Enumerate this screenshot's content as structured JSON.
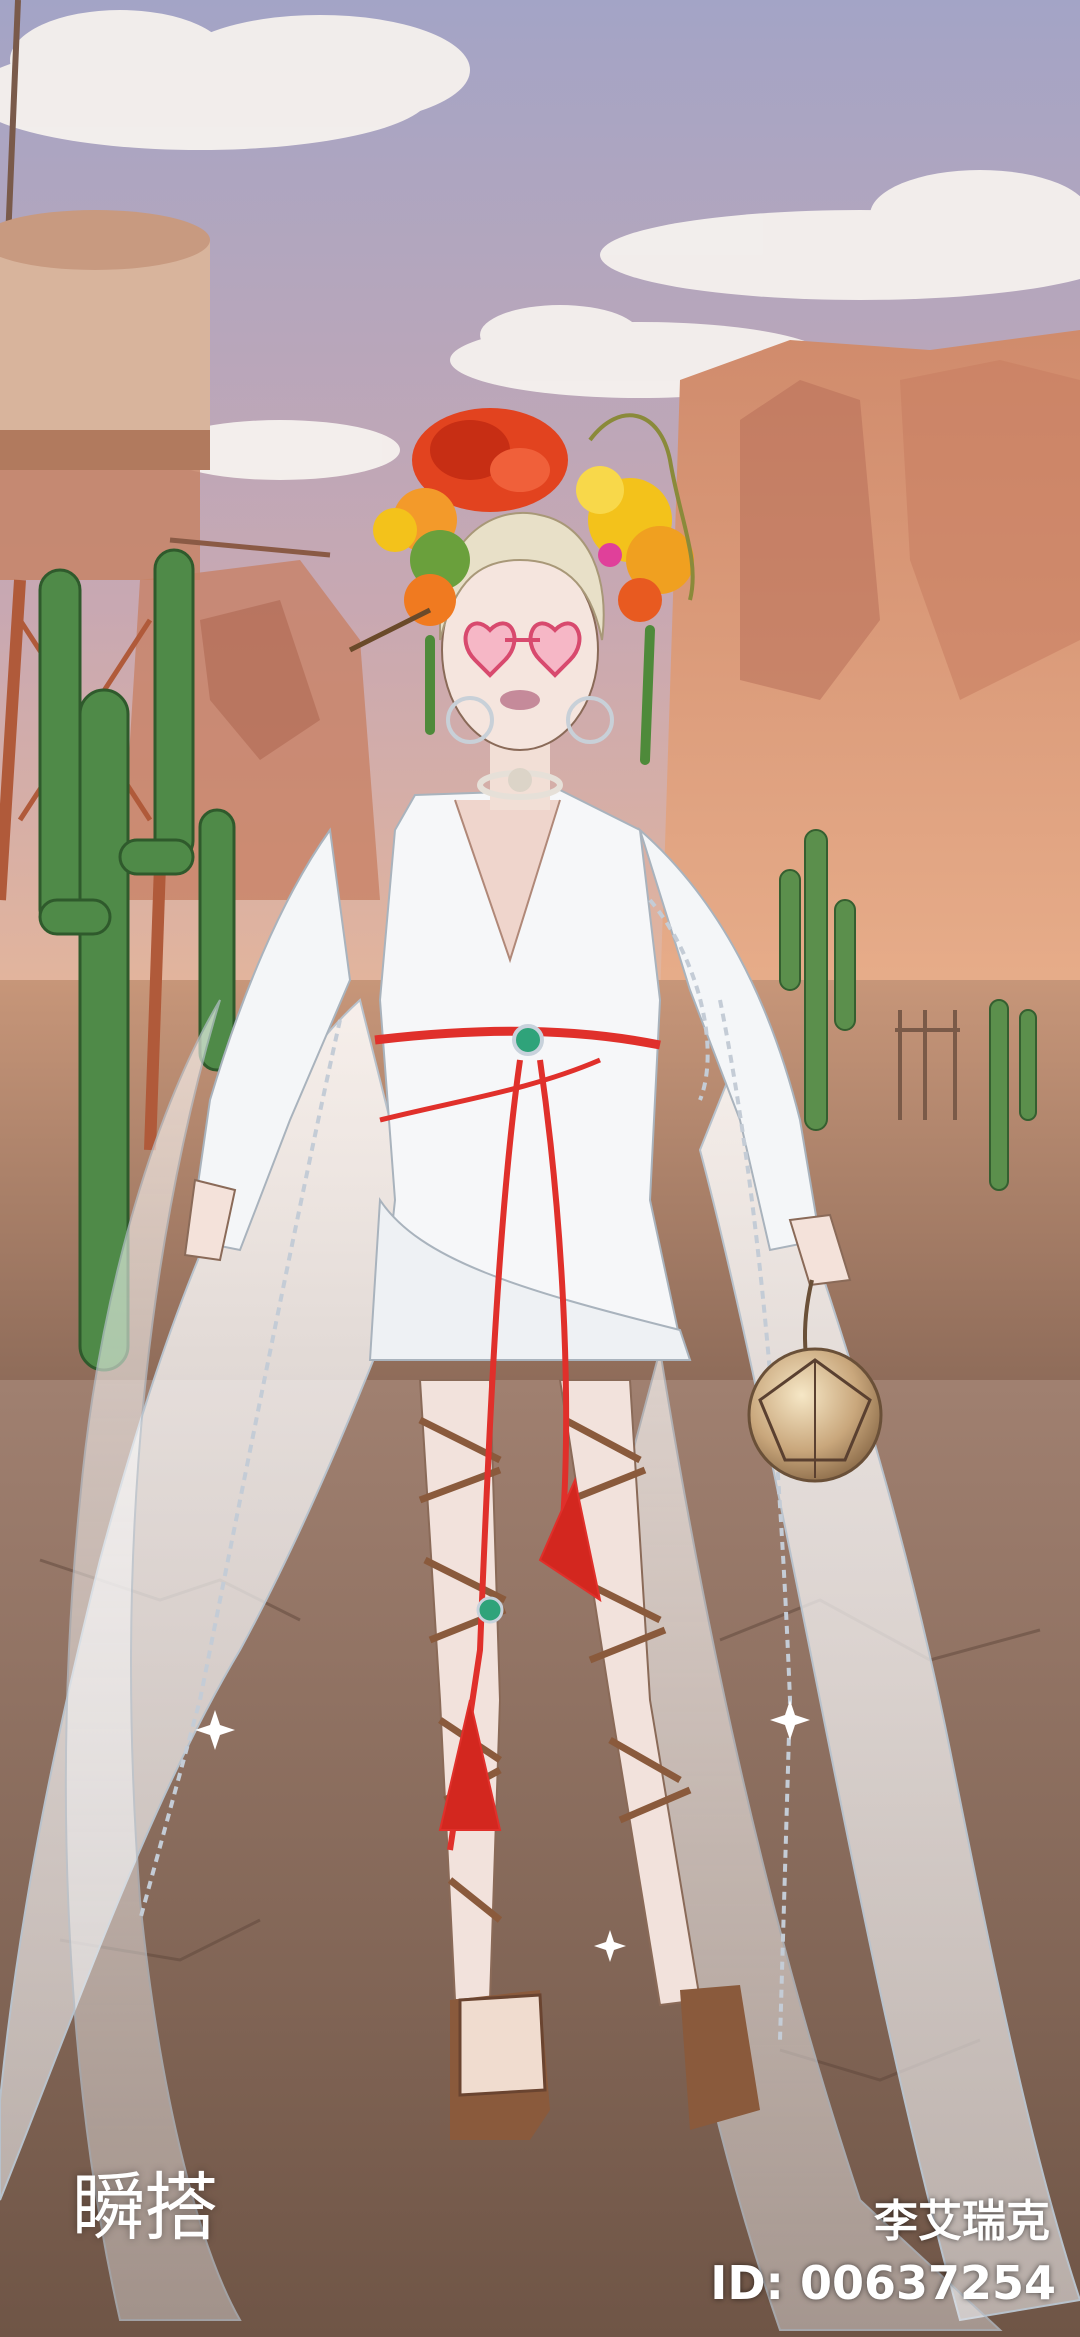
{
  "brand": {
    "logo_text": "瞬搭"
  },
  "player": {
    "name": "李艾瑞克",
    "id_text": "ID: 00637254"
  },
  "colors": {
    "sky_top": "#a7a6c6",
    "sky_bottom": "#e8b79a",
    "cliff": "#c47d62",
    "ground": "#9a7560",
    "road": "#8a6c5c",
    "cactus": "#4f8a48",
    "dress": "#f4f6f8",
    "accent_red": "#e0302b",
    "rose": "#e2431f",
    "flower_yellow": "#f3c21b"
  },
  "icons": [
    "water-tower",
    "cactus",
    "rose-headpiece",
    "heart-sunglasses",
    "orb-handbag",
    "wedge-sandals"
  ]
}
